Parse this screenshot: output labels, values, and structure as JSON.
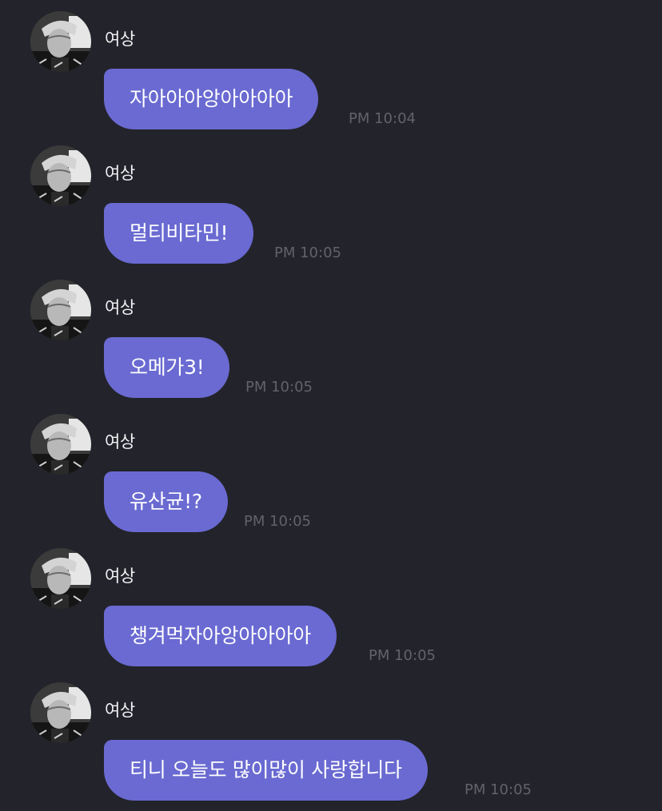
{
  "colors": {
    "background": "#23232b",
    "bubble": "#6a6ad2",
    "bubble_text": "#ffffff",
    "sender_text": "#f2f2f4",
    "timestamp_text": "#62626c"
  },
  "messages": [
    {
      "sender": "여상",
      "avatar": "profile-photo-icon",
      "text": "자아아아앙아아아아",
      "time": "PM 10:04"
    },
    {
      "sender": "여상",
      "avatar": "profile-photo-icon",
      "text": "멀티비타민!",
      "time": "PM 10:05"
    },
    {
      "sender": "여상",
      "avatar": "profile-photo-icon",
      "text": "오메가3!",
      "time": "PM 10:05"
    },
    {
      "sender": "여상",
      "avatar": "profile-photo-icon",
      "text": "유산균!?",
      "time": "PM 10:05"
    },
    {
      "sender": "여상",
      "avatar": "profile-photo-icon",
      "text": "챙겨먹자아앙아아아아",
      "time": "PM 10:05"
    },
    {
      "sender": "여상",
      "avatar": "profile-photo-icon",
      "text": "티니 오늘도 많이많이 사랑합니다",
      "time": "PM 10:05"
    }
  ]
}
